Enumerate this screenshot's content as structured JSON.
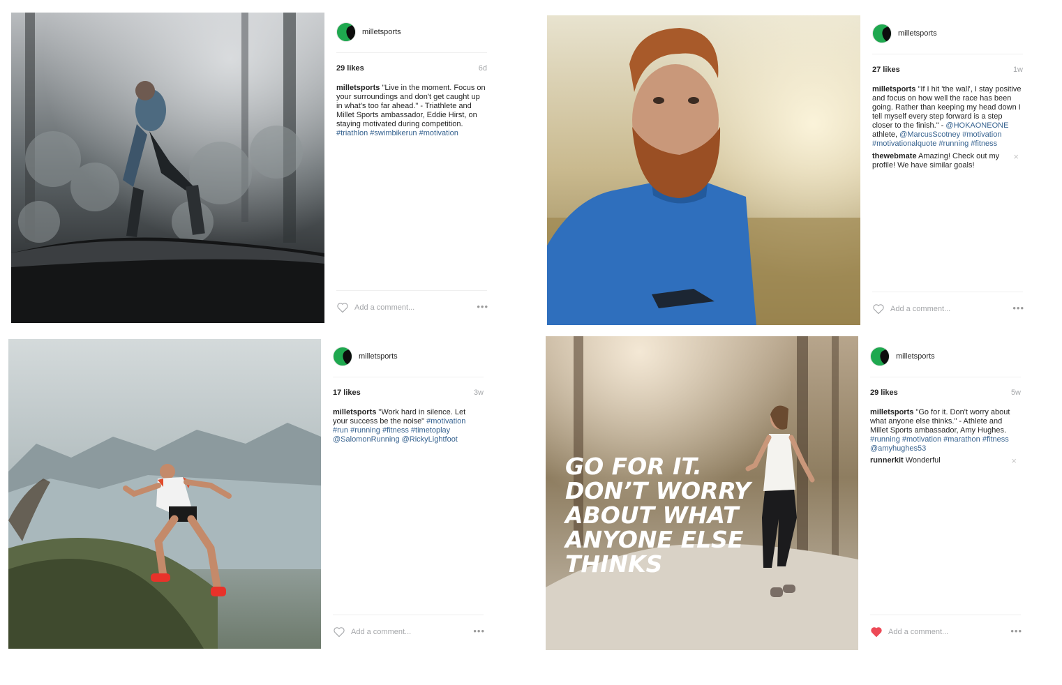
{
  "posts": [
    {
      "username": "milletsports",
      "likes": "29 likes",
      "ago": "6d",
      "caption_user": "milletsports",
      "caption_text": "\"Live in the moment. Focus on your surroundings and don't get caught up in what's too far ahead.\" - Triathlete and Millet Sports ambassador, Eddie Hirst, on staying motivated during competition.",
      "tags": "#triathlon #swimbikerun #motivation",
      "add_comment": "Add a comment...",
      "more": "•••",
      "liked": false
    },
    {
      "username": "milletsports",
      "likes": "27 likes",
      "ago": "1w",
      "caption_user": "milletsports",
      "caption_text": "\"If I hit 'the wall', I stay positive and focus on how well the race has been going. Rather than keeping my head down I tell myself every step forward is a step closer to the finish.\" -",
      "mention_1": "@HOKAONEONE",
      "caption_text_2": "athlete,",
      "mention_2": "@MarcusScotney",
      "tags": "#motivation #motivationalquote #running #fitness",
      "comment_user": "thewebmate",
      "comment_text": "Amazing! Check out my profile! We have similar goals!",
      "comment_close": "×",
      "add_comment": "Add a comment...",
      "more": "•••",
      "liked": false
    },
    {
      "username": "milletsports",
      "likes": "17 likes",
      "ago": "3w",
      "caption_user": "milletsports",
      "caption_text": "\"Work hard in silence. Let your success be the noise\"",
      "tags": "#motivation #run #running #fitness #timetoplay @SalomonRunning @RickyLightfoot",
      "add_comment": "Add a comment...",
      "more": "•••",
      "liked": false
    },
    {
      "username": "milletsports",
      "likes": "29 likes",
      "ago": "5w",
      "caption_user": "milletsports",
      "caption_text": "\"Go for it. Don't worry about what anyone else thinks.\" - Athlete and Millet Sports ambassador, Amy Hughes.",
      "tags": "#running #motivation #marathon #fitness @amyhughes53",
      "comment_user": "runnerkit",
      "comment_text": "Wonderful",
      "comment_close": "×",
      "add_comment": "Add a comment...",
      "more": "•••",
      "liked": true
    }
  ],
  "image_overlay": {
    "line1": "GO FOR IT.",
    "line2": "DON’T WORRY",
    "line3": "ABOUT WHAT",
    "line4": "ANYONE ELSE",
    "line5": "THINKS"
  },
  "colors": {
    "link": "#36628f",
    "brand_green": "#1fa84f",
    "heart_liked": "#ed4956",
    "muted": "#a5a7aa"
  }
}
